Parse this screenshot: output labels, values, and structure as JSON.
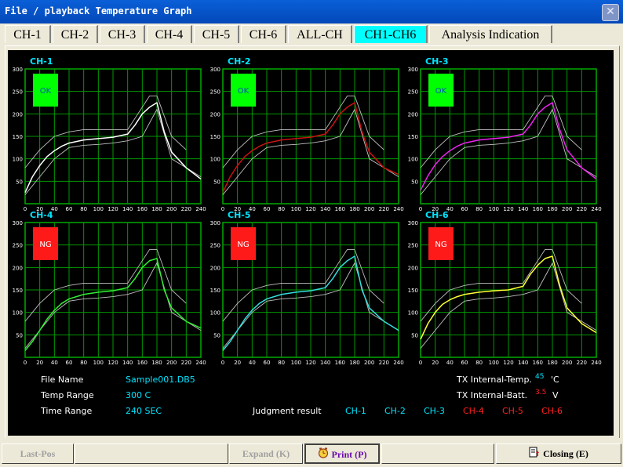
{
  "window": {
    "title": "File / playback Temperature Graph",
    "close_glyph": "✕"
  },
  "tabs": [
    {
      "label": "CH-1",
      "active": false
    },
    {
      "label": "CH-2",
      "active": false
    },
    {
      "label": "CH-3",
      "active": false
    },
    {
      "label": "CH-4",
      "active": false
    },
    {
      "label": "CH-5",
      "active": false
    },
    {
      "label": "CH-6",
      "active": false
    },
    {
      "label": "ALL-CH",
      "active": false
    },
    {
      "label": "CH1-CH6",
      "active": true
    },
    {
      "label": "Analysis Indication",
      "active": false
    }
  ],
  "chart_data": [
    {
      "type": "line",
      "title": "CH-1",
      "status": "OK",
      "status_color": "#00ff00",
      "trace_color": "#ffffff",
      "xlim": [
        0,
        240
      ],
      "ylim": [
        0,
        300
      ],
      "x": [
        0,
        10,
        20,
        30,
        40,
        50,
        60,
        80,
        100,
        120,
        140,
        150,
        160,
        170,
        180,
        190,
        200,
        220,
        240
      ],
      "values": [
        25,
        60,
        85,
        105,
        118,
        128,
        135,
        142,
        145,
        148,
        155,
        175,
        200,
        215,
        225,
        160,
        115,
        80,
        55
      ]
    },
    {
      "type": "line",
      "title": "CH-2",
      "status": "OK",
      "status_color": "#00ff00",
      "trace_color": "#cc1111",
      "xlim": [
        0,
        240
      ],
      "ylim": [
        0,
        300
      ],
      "x": [
        0,
        10,
        20,
        30,
        40,
        50,
        60,
        80,
        100,
        120,
        140,
        150,
        160,
        170,
        180,
        190,
        200,
        220,
        240
      ],
      "values": [
        25,
        60,
        85,
        105,
        118,
        128,
        135,
        142,
        145,
        148,
        155,
        175,
        200,
        215,
        225,
        160,
        115,
        80,
        65
      ]
    },
    {
      "type": "line",
      "title": "CH-3",
      "status": "OK",
      "status_color": "#00ff00",
      "trace_color": "#ee22ee",
      "xlim": [
        0,
        240
      ],
      "ylim": [
        0,
        300
      ],
      "x": [
        0,
        10,
        20,
        30,
        40,
        50,
        60,
        80,
        100,
        120,
        140,
        150,
        160,
        170,
        180,
        190,
        200,
        220,
        240
      ],
      "values": [
        30,
        62,
        87,
        105,
        118,
        128,
        135,
        142,
        145,
        148,
        155,
        175,
        200,
        215,
        225,
        165,
        120,
        80,
        55
      ]
    },
    {
      "type": "line",
      "title": "CH-4",
      "status": "NG",
      "status_color": "#ff1a1a",
      "trace_color": "#33ee33",
      "xlim": [
        0,
        240
      ],
      "ylim": [
        0,
        300
      ],
      "x": [
        0,
        10,
        20,
        30,
        40,
        50,
        60,
        80,
        100,
        120,
        140,
        150,
        160,
        170,
        180,
        190,
        200,
        220,
        240
      ],
      "values": [
        15,
        35,
        60,
        85,
        105,
        120,
        130,
        140,
        145,
        148,
        155,
        175,
        200,
        215,
        220,
        150,
        110,
        80,
        65
      ]
    },
    {
      "type": "line",
      "title": "CH-5",
      "status": "NG",
      "status_color": "#ff1a1a",
      "trace_color": "#33dddd",
      "xlim": [
        0,
        240
      ],
      "ylim": [
        0,
        300
      ],
      "x": [
        0,
        10,
        20,
        30,
        40,
        50,
        60,
        80,
        100,
        120,
        140,
        150,
        160,
        170,
        180,
        190,
        200,
        220,
        240
      ],
      "values": [
        15,
        35,
        60,
        85,
        105,
        120,
        130,
        140,
        145,
        148,
        155,
        175,
        200,
        215,
        225,
        150,
        110,
        80,
        60
      ]
    },
    {
      "type": "line",
      "title": "CH-6",
      "status": "NG",
      "status_color": "#ff1a1a",
      "trace_color": "#ffff33",
      "xlim": [
        0,
        240
      ],
      "ylim": [
        0,
        300
      ],
      "x": [
        0,
        10,
        20,
        30,
        40,
        50,
        60,
        80,
        100,
        120,
        140,
        150,
        160,
        170,
        180,
        190,
        200,
        220,
        240
      ],
      "values": [
        40,
        75,
        100,
        118,
        128,
        135,
        140,
        145,
        148,
        150,
        158,
        185,
        205,
        220,
        225,
        160,
        110,
        75,
        55
      ]
    }
  ],
  "envelope": {
    "upper": {
      "x": [
        0,
        10,
        20,
        40,
        60,
        80,
        100,
        120,
        140,
        150,
        170,
        180,
        200,
        220
      ],
      "values": [
        80,
        100,
        120,
        150,
        160,
        165,
        165,
        165,
        165,
        190,
        240,
        240,
        150,
        120
      ]
    },
    "lower": {
      "x": [
        0,
        20,
        40,
        60,
        80,
        100,
        120,
        140,
        160,
        180,
        200,
        220,
        240
      ],
      "values": [
        20,
        60,
        100,
        125,
        130,
        132,
        135,
        140,
        150,
        210,
        100,
        80,
        60
      ]
    }
  },
  "axis": {
    "x_ticks": [
      "0",
      "20",
      "40",
      "60",
      "80",
      "100",
      "120",
      "140",
      "160",
      "180",
      "200",
      "220",
      "240"
    ],
    "y_ticks": [
      "300",
      "250",
      "200",
      "150",
      "100",
      "50"
    ]
  },
  "info": {
    "file_name_label": "File Name",
    "file_name": "Sample001.DB5",
    "temp_range_label": "Temp Range",
    "temp_range": "300 C",
    "time_range_label": "Time Range",
    "time_range": "240 SEC",
    "tx_temp_label": "TX Internal-Temp.",
    "tx_temp_value": "45",
    "tx_temp_unit": "'C",
    "tx_batt_label": "TX Internal-Batt.",
    "tx_batt_value": "3.5",
    "tx_batt_unit": "V",
    "judgment_label": "Judgment result",
    "judgment": [
      {
        "label": "CH-1",
        "color": "#00e5ff"
      },
      {
        "label": "CH-2",
        "color": "#00e5ff"
      },
      {
        "label": "CH-3",
        "color": "#00e5ff"
      },
      {
        "label": "CH-4",
        "color": "#ff2020"
      },
      {
        "label": "CH-5",
        "color": "#ff2020"
      },
      {
        "label": "CH-6",
        "color": "#ff2020"
      }
    ]
  },
  "buttons": {
    "last_pos": "Last-Pos",
    "expand": "Expand (K)",
    "print": "Print (P)",
    "closing": "Closing (E)"
  }
}
